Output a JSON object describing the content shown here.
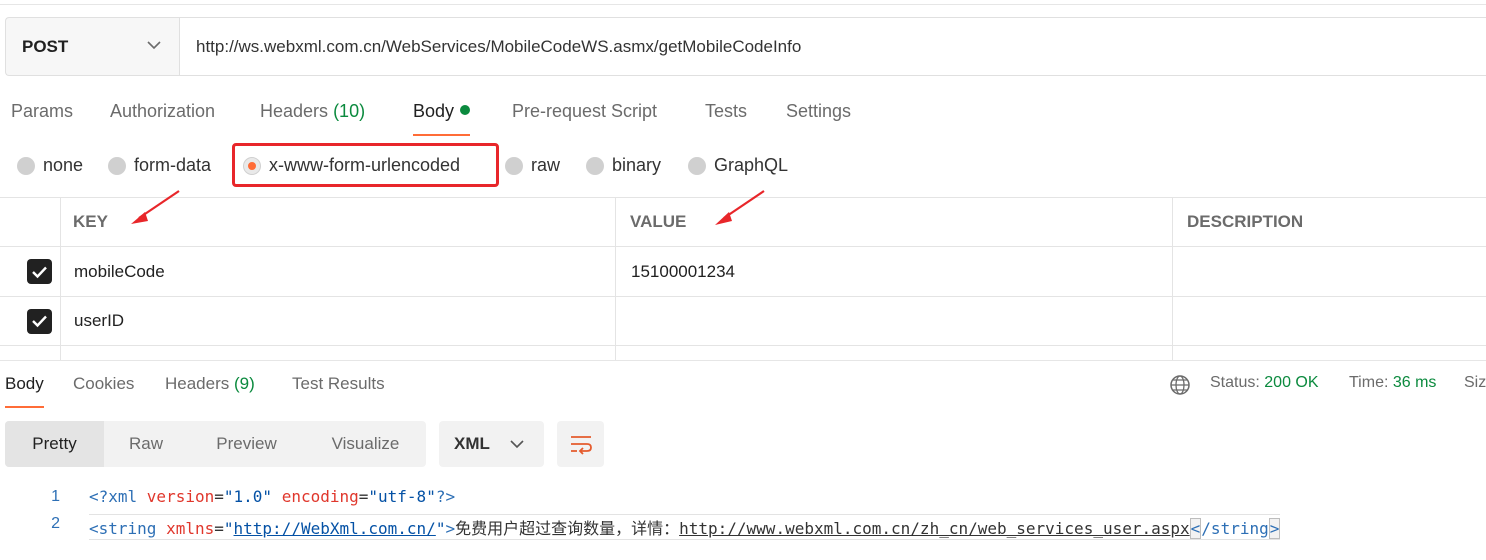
{
  "request": {
    "method": "POST",
    "url": "http://ws.webxml.com.cn/WebServices/MobileCodeWS.asmx/getMobileCodeInfo"
  },
  "request_tabs": [
    {
      "label": "Params"
    },
    {
      "label": "Authorization"
    },
    {
      "label": "Headers",
      "count": "(10)"
    },
    {
      "label": "Body",
      "active": true
    },
    {
      "label": "Pre-request Script"
    },
    {
      "label": "Tests"
    },
    {
      "label": "Settings"
    }
  ],
  "body_types": [
    {
      "label": "none"
    },
    {
      "label": "form-data"
    },
    {
      "label": "x-www-form-urlencoded",
      "selected": true
    },
    {
      "label": "raw"
    },
    {
      "label": "binary"
    },
    {
      "label": "GraphQL"
    }
  ],
  "params_table": {
    "headers": [
      "KEY",
      "VALUE",
      "DESCRIPTION"
    ],
    "rows": [
      {
        "checked": true,
        "key": "mobileCode",
        "value": "15100001234",
        "description": ""
      },
      {
        "checked": true,
        "key": "userID",
        "value": "",
        "description": ""
      }
    ]
  },
  "response_tabs": [
    {
      "label": "Body",
      "active": true
    },
    {
      "label": "Cookies"
    },
    {
      "label": "Headers",
      "count": "(9)"
    },
    {
      "label": "Test Results"
    }
  ],
  "response_meta": {
    "status_label": "Status:",
    "status_value": "200 OK",
    "time_label": "Time:",
    "time_value": "36 ms",
    "size_label": "Siz"
  },
  "view_modes": [
    "Pretty",
    "Raw",
    "Preview",
    "Visualize"
  ],
  "format": "XML",
  "code": {
    "line1": {
      "num": "1",
      "open": "<?xml ",
      "attr1": "version",
      "eq1": "=",
      "val1": "\"1.0\"",
      "attr2": "encoding",
      "eq2": "=",
      "val2": "\"utf-8\"",
      "close": "?>"
    },
    "line2": {
      "num": "2",
      "open": "<string ",
      "attr": "xmlns",
      "eq": "=",
      "q1": "\"",
      "link": "http://WebXml.com.cn/",
      "q2": "\"",
      "gt": ">",
      "text": "免费用户超过查询数量，详情：",
      "url": "http://www.webxml.com.cn/zh_cn/web_services_user.aspx",
      "lt": "<",
      "close": "/string",
      "end": ">"
    }
  },
  "colors": {
    "accent": "#ff6c37",
    "success": "#0b8a3e",
    "annotation": "#e8262a"
  }
}
